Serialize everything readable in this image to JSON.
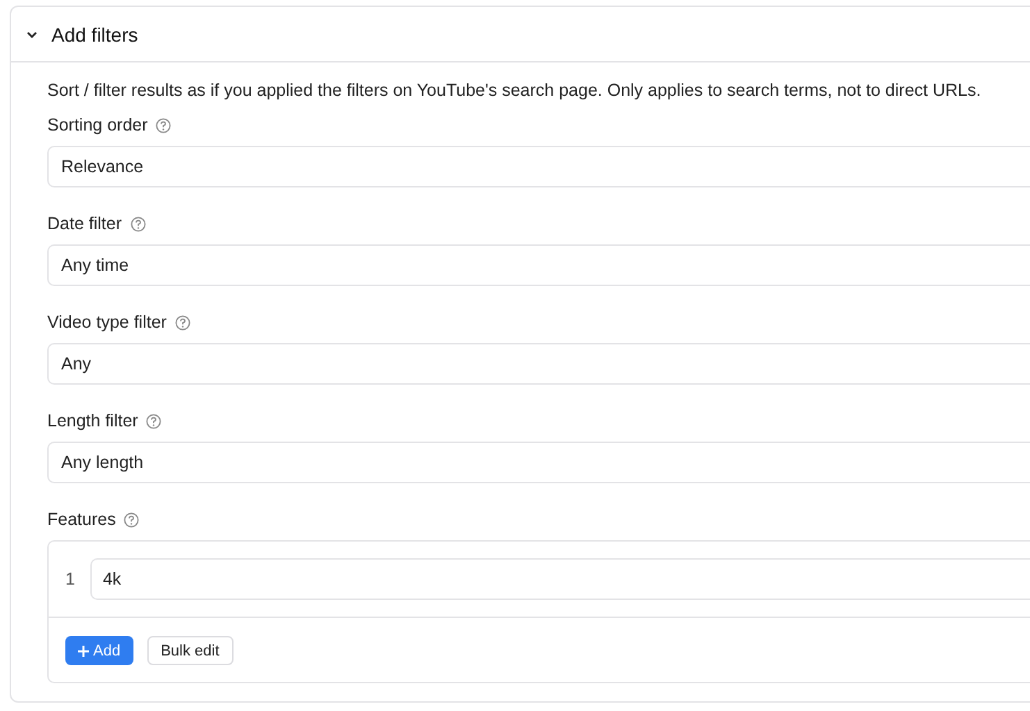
{
  "section": {
    "title": "Add filters",
    "expanded": true,
    "description": "Sort / filter results as if you applied the filters on YouTube's search page. Only applies to search terms, not to direct URLs.",
    "fields": [
      {
        "label": "Sorting order",
        "value": "Relevance"
      },
      {
        "label": "Date filter",
        "value": "Any time"
      },
      {
        "label": "Video type filter",
        "value": "Any"
      },
      {
        "label": "Length filter",
        "value": "Any length"
      }
    ],
    "features": {
      "label": "Features",
      "items": [
        {
          "index": "1",
          "value": "4k"
        }
      ],
      "add_button": "Add",
      "bulk_button": "Bulk edit"
    }
  }
}
